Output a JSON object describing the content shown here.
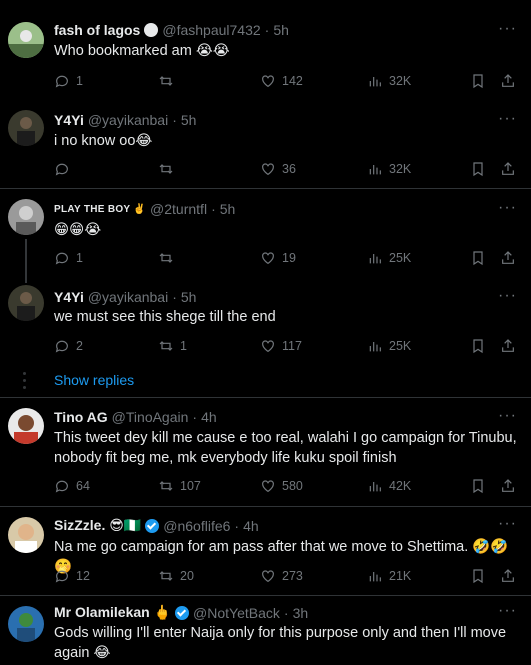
{
  "tweets": [
    {
      "name": "fash of lagos",
      "handle": "@fashpaul7432",
      "time": "5h",
      "text": "Who bookmarked am 😭😭",
      "replies": "1",
      "retweets": "",
      "likes": "142",
      "views": "32K",
      "avatar_color": "#6b8f5e"
    },
    {
      "name": "Y4Yi",
      "handle": "@yayikanbai",
      "time": "5h",
      "text": "i no know oo😂",
      "replies": "",
      "retweets": "",
      "likes": "36",
      "views": "32K",
      "avatar_color": "#3a3a2e"
    },
    {
      "name": "PLAY THE BOY ✌️",
      "handle": "@2turntfl",
      "time": "5h",
      "text": "😁😁😭",
      "replies": "1",
      "retweets": "",
      "likes": "19",
      "views": "25K",
      "avatar_color": "#8a8a8a"
    },
    {
      "name": "Y4Yi",
      "handle": "@yayikanbai",
      "time": "5h",
      "text": "we must see this shege till the end",
      "replies": "2",
      "retweets": "1",
      "likes": "117",
      "views": "25K",
      "avatar_color": "#3a3a2e"
    },
    {
      "name": "Tino AG",
      "handle": "@TinoAgain",
      "time": "4h",
      "text": "This tweet dey kill me cause e too real, walahi I go campaign for Tinubu, nobody fit beg me, mk everybody life kuku spoil finish",
      "replies": "64",
      "retweets": "107",
      "likes": "580",
      "views": "42K",
      "avatar_color": "#c43a2c"
    },
    {
      "name": "SizZzle. 😎🇳🇬",
      "handle": "@n6oflife6",
      "time": "4h",
      "text": "Na me go campaign for am pass after that we move to Shettima. 🤣🤣🤭",
      "replies": "12",
      "retweets": "20",
      "likes": "273",
      "views": "21K",
      "avatar_color": "#d8c9a8"
    },
    {
      "name": "Mr Olamilekan 🖕",
      "handle": "@NotYetBack",
      "time": "3h",
      "text": "Gods willing I'll enter Naija only for this purpose only and then I'll move again 😂",
      "replies": "",
      "retweets": "",
      "likes": "",
      "views": "",
      "avatar_color": "#2a6fb0"
    }
  ],
  "show_replies": "Show replies",
  "dot": "·",
  "more": "···"
}
